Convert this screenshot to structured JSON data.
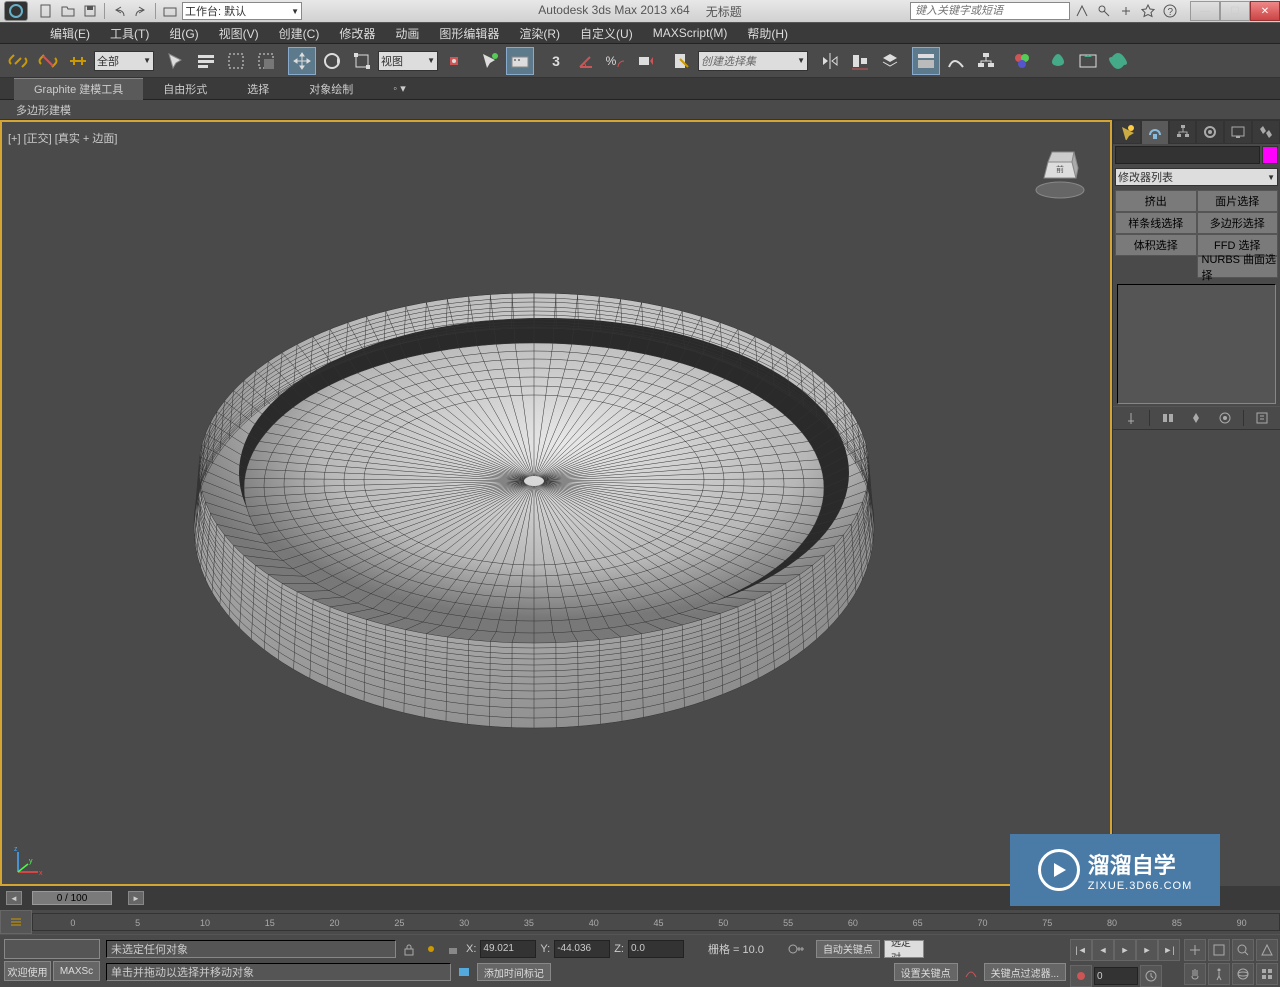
{
  "titlebar": {
    "workspace": "工作台: 默认",
    "app_title": "Autodesk 3ds Max  2013 x64",
    "doc_title": "无标题",
    "search_placeholder": "键入关键字或短语"
  },
  "menubar": {
    "items": [
      "编辑(E)",
      "工具(T)",
      "组(G)",
      "视图(V)",
      "创建(C)",
      "修改器",
      "动画",
      "图形编辑器",
      "渲染(R)",
      "自定义(U)",
      "MAXScript(M)",
      "帮助(H)"
    ]
  },
  "maintoolbar": {
    "selection_filter": "全部",
    "ref_coord": "视图",
    "angle_snap": "3",
    "named_set": "创建选择集"
  },
  "ribbon": {
    "tabs": [
      "Graphite 建模工具",
      "自由形式",
      "选择",
      "对象绘制"
    ],
    "sub": "多边形建模"
  },
  "viewport": {
    "label": "[+] [正交] [真实 + 边面]"
  },
  "cmdpanel": {
    "modifier_list": "修改器列表",
    "mod_buttons": [
      [
        "挤出",
        "面片选择"
      ],
      [
        "样条线选择",
        "多边形选择"
      ],
      [
        "体积选择",
        "FFD 选择"
      ],
      [
        "",
        "NURBS 曲面选择"
      ]
    ]
  },
  "timeline": {
    "frame_display": "0 / 100",
    "ticks": [
      0,
      5,
      10,
      15,
      20,
      25,
      30,
      35,
      40,
      45,
      50,
      55,
      60,
      65,
      70,
      75,
      80,
      85,
      90
    ]
  },
  "statusbar": {
    "welcome": "欢迎使用",
    "maxscript": "MAXSc",
    "prompt1": "未选定任何对象",
    "prompt2": "单击并拖动以选择并移动对象",
    "x_label": "X:",
    "x_val": "49.021",
    "y_label": "Y:",
    "y_val": "-44.036",
    "z_label": "Z:",
    "z_val": "0.0",
    "grid": "栅格 = 10.0",
    "add_time_tag": "添加时间标记",
    "auto_key": "自动关键点",
    "set_key": "设置关键点",
    "selected": "选定对",
    "key_filters": "关键点过滤器...",
    "frame": "0"
  },
  "watermark": {
    "main": "溜溜自学",
    "sub": "ZIXUE.3D66.COM"
  }
}
